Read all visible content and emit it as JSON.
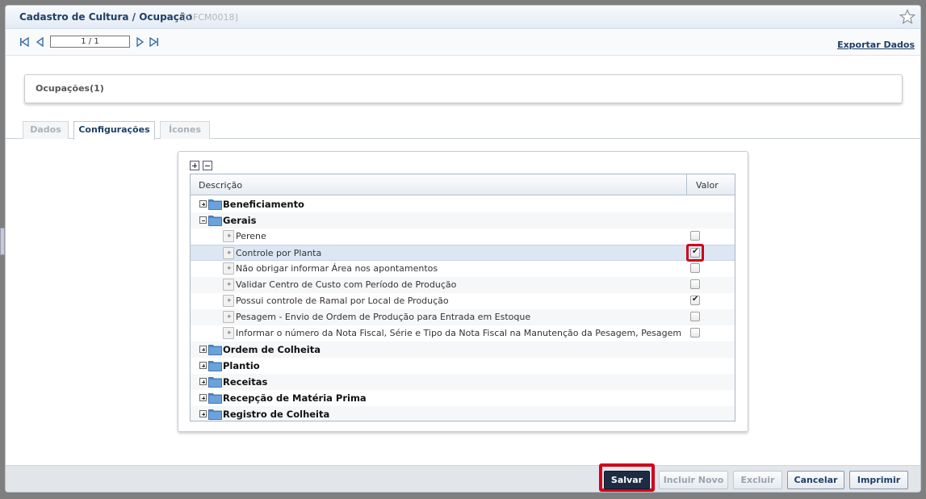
{
  "header": {
    "title": "Cadastro de Cultura / Ocupação",
    "code": "[CFCM0018]"
  },
  "nav": {
    "page": "1 / 1",
    "export_label": "Exportar Dados"
  },
  "group": {
    "title": "Ocupações(1)"
  },
  "tabs": [
    {
      "label": "Dados",
      "active": false
    },
    {
      "label": "Configurações",
      "active": true
    },
    {
      "label": "Ícones",
      "active": false
    }
  ],
  "grid": {
    "col_desc": "Descrição",
    "col_value": "Valor",
    "rows": [
      {
        "label": "Beneficiamento",
        "type": "group",
        "expanded": false
      },
      {
        "label": "Gerais",
        "type": "group",
        "expanded": true
      },
      {
        "label": "Perene",
        "type": "leaf",
        "checked": false
      },
      {
        "label": "Controle por Planta",
        "type": "leaf",
        "checked": true,
        "selected": true
      },
      {
        "label": "Não obrigar informar Área nos apontamentos",
        "type": "leaf",
        "checked": false
      },
      {
        "label": "Validar Centro de Custo com Período de Produção",
        "type": "leaf",
        "checked": false
      },
      {
        "label": "Possui controle de Ramal por Local de Produção",
        "type": "leaf",
        "checked": true
      },
      {
        "label": "Pesagem - Envio de Ordem de Produção para Entrada em Estoque",
        "type": "leaf",
        "checked": false
      },
      {
        "label": "Informar o número da Nota Fiscal, Série e Tipo da Nota Fiscal na Manutenção da Pesagem, Pesagem e Registro de",
        "type": "leaf",
        "checked": false
      },
      {
        "label": "Ordem de Colheita",
        "type": "group",
        "expanded": false
      },
      {
        "label": "Plantio",
        "type": "group",
        "expanded": false
      },
      {
        "label": "Receitas",
        "type": "group",
        "expanded": false
      },
      {
        "label": "Recepção de Matéria Prima",
        "type": "group",
        "expanded": false
      },
      {
        "label": "Registro de Colheita",
        "type": "group",
        "expanded": false
      }
    ]
  },
  "footer": {
    "save": "Salvar",
    "new": "Incluir Novo",
    "delete": "Excluir",
    "cancel": "Cancelar",
    "print": "Imprimir"
  },
  "colors": {
    "accent": "#1f3f66",
    "highlight": "#d0001b",
    "primary_button": "#1d2b44"
  }
}
